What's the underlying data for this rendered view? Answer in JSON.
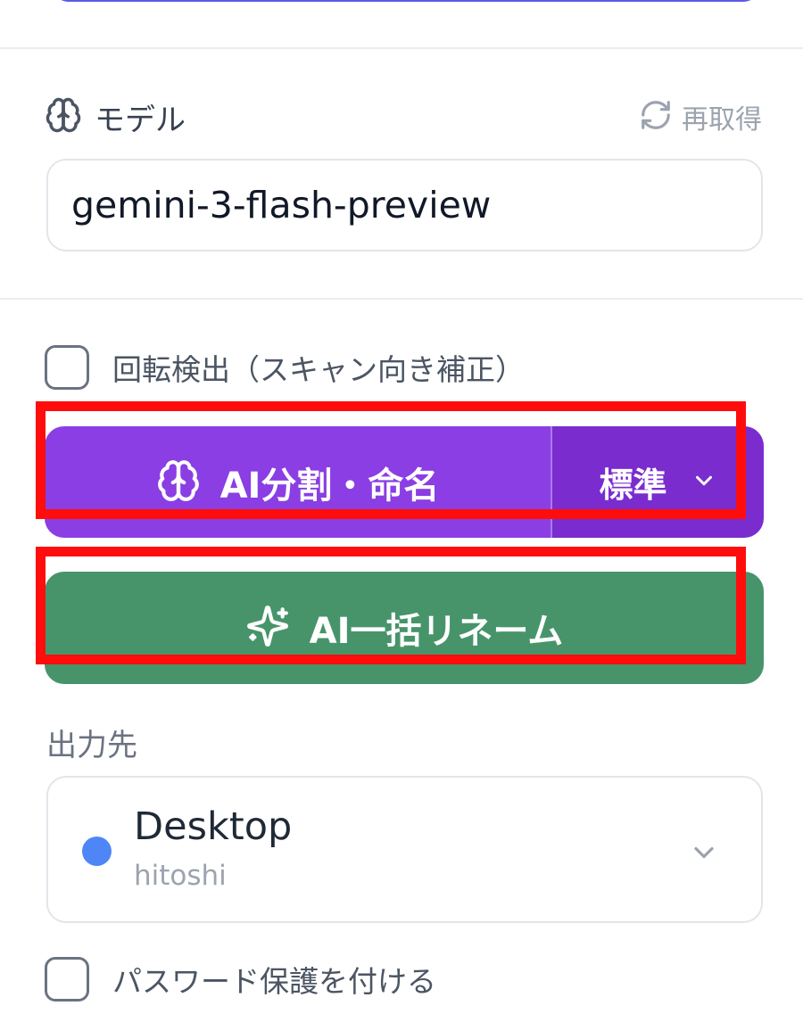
{
  "model": {
    "label": "モデル",
    "label_icon": "brain-icon",
    "refresh_label": "再取得",
    "refresh_icon": "refresh-icon",
    "value": "gemini-3-flash-preview"
  },
  "rotation_detect": {
    "label": "回転検出（スキャン向き補正）",
    "checked": false
  },
  "ai_split": {
    "label": "AI分割・命名",
    "icon": "brain-icon",
    "mode_label": "標準",
    "color": "#8a3ee3",
    "mode_color": "#7a2ccf"
  },
  "ai_rename": {
    "label": "AI一括リネーム",
    "icon": "sparkle-icon",
    "color": "#47946b"
  },
  "output": {
    "label": "出力先",
    "destination_name": "Desktop",
    "destination_user": "hitoshi",
    "dot_color": "#4f86f7"
  },
  "password_protect": {
    "label": "パスワード保護を付ける",
    "checked": false
  },
  "highlight_color": "#ff0d0d"
}
